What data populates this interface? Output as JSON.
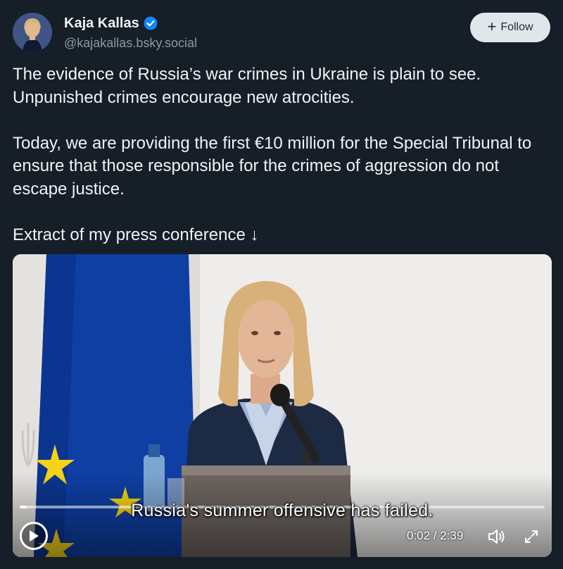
{
  "author": {
    "display_name": "Kaja Kallas",
    "handle": "@kajakallas.bsky.social",
    "verified": true
  },
  "follow_button": {
    "label": "Follow",
    "icon": "plus-icon"
  },
  "post": {
    "paragraphs": [
      "The evidence of Russia’s war crimes in Ukraine is plain to see. Unpunished crimes encourage new atrocities.",
      "Today, we are providing the first €10 million for the Special Tribunal to ensure that those responsible for the crimes of aggression do not escape justice.",
      "Extract of my press conference ↓"
    ]
  },
  "video": {
    "subtitle": "Russia's summer offensive has failed.",
    "time_display": "0:02 / 2:39",
    "progress_fraction": 0.013,
    "controls": {
      "play_icon": "play-icon",
      "volume_icon": "volume-icon",
      "fullscreen_icon": "fullscreen-icon"
    }
  },
  "colors": {
    "background": "#161e27",
    "verified_badge": "#1185fe",
    "follow_button_bg": "#e1e6eb",
    "eu_flag_blue": "#0f3fa3",
    "eu_star_yellow": "#f7d315"
  }
}
